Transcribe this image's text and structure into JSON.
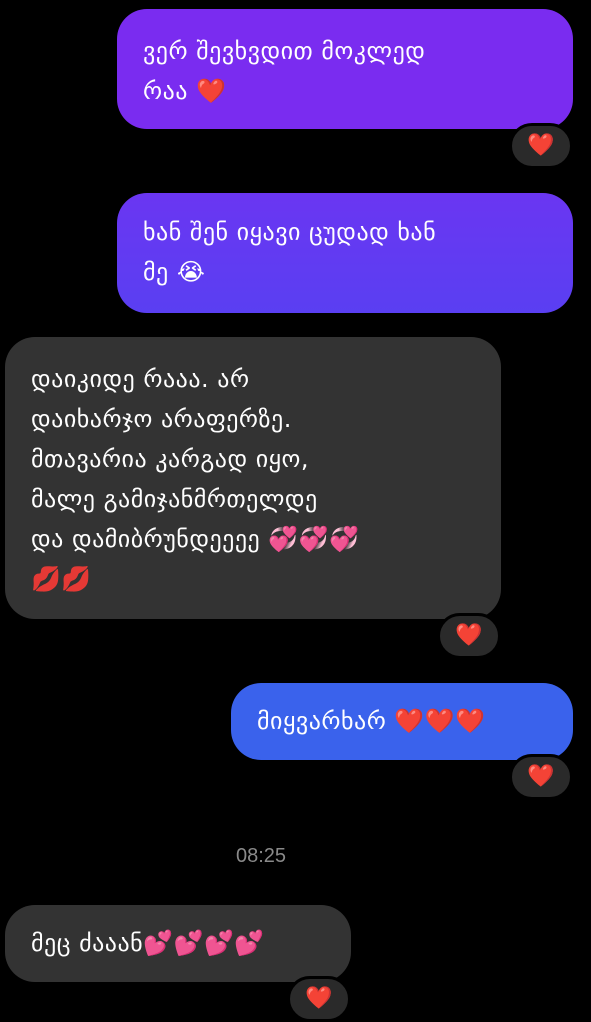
{
  "colors": {
    "background": "#000000",
    "sent_bubble_purple": "#7a2cf0",
    "sent_bubble_violet": "#5a3ff2",
    "sent_bubble_blue": "#3a62ec",
    "received_bubble": "#333333",
    "reaction_pill": "#2a2a2a",
    "timestamp_text": "#8a8a8a"
  },
  "messages": [
    {
      "direction": "sent",
      "text": "ვერ შევხვდით მოკლედ\nრაა ❤️"
    },
    {
      "direction": "sent",
      "text": "ხან შენ იყავი ცუდად ხან\nმე 😭"
    },
    {
      "direction": "received",
      "text": "დაიკიდე რააა. არ\nდაიხარჯო არაფერზე.\nმთავარია კარგად იყო,\nმალე გამიჯანმრთელდე\nდა დამიბრუნდეეეე 💞💞💞\n💋💋"
    },
    {
      "direction": "sent",
      "text": "მიყვარხარ ❤️❤️❤️"
    },
    {
      "direction": "received",
      "text": "მეც ძააან💕💕💕💕"
    }
  ],
  "reactions": [
    {
      "emoji": "❤️"
    },
    {
      "emoji": "❤️"
    },
    {
      "emoji": "❤️"
    },
    {
      "emoji": "❤️"
    }
  ],
  "timestamp": "08:25"
}
